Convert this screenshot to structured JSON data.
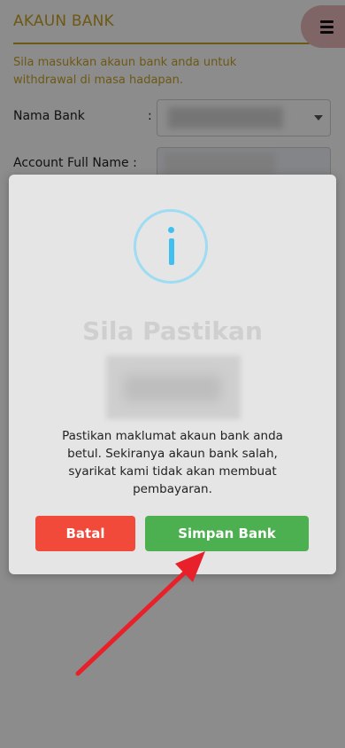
{
  "page": {
    "title": "AKAUN BANK",
    "intro": "Sila masukkan akaun bank anda untuk withdrawal di masa hadapan.",
    "bank_label": "Nama Bank",
    "colon": ":",
    "name_label": "Account Full Name :",
    "menu_icon": "hamburger-icon"
  },
  "dialog": {
    "icon": "info-icon",
    "title": "Sila Pastikan",
    "message": "Pastikan maklumat akaun bank anda betul. Sekiranya akaun bank salah, syarikat kami tidak akan membuat pembayaran.",
    "cancel_label": "Batal",
    "save_label": "Simpan Bank"
  },
  "colors": {
    "accent": "#c7a227",
    "cancel": "#f24a3a",
    "save": "#4caf50",
    "info": "#3fc0f0",
    "annotation_arrow": "#e8202a"
  }
}
